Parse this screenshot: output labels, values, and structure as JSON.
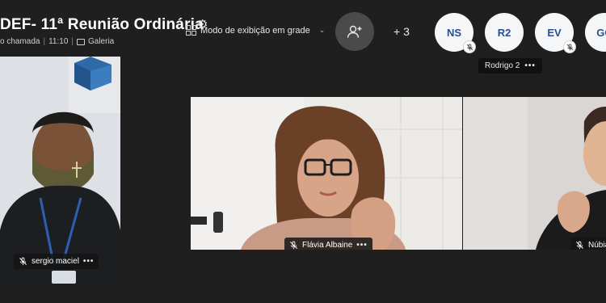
{
  "header": {
    "title": "DEF- 11ª Reunião Ordinária",
    "call_label": "o chamada",
    "time": "11:10",
    "gallery_label": "Galeria",
    "view_mode_label": "Modo de exibição em grade",
    "more_participants": "+ 3"
  },
  "participants_bar": [
    {
      "initials": "NS",
      "muted": true
    },
    {
      "initials": "R2",
      "muted": false
    },
    {
      "initials": "EV",
      "muted": true
    },
    {
      "initials": "GC",
      "muted": false
    }
  ],
  "hover_card": {
    "name": "Rodrigo 2"
  },
  "tiles": [
    {
      "name": "sergio maciel"
    },
    {
      "name": "Flávia Albaine"
    },
    {
      "name": "Núbia"
    }
  ],
  "colors": {
    "background": "#1f1f1f",
    "avatar_bg": "#f4f6f8",
    "avatar_text": "#2b4f8c",
    "add_person_bg": "#4a4a4a"
  },
  "icons": [
    "gear-icon",
    "grid-view-icon",
    "chevron-down-icon",
    "add-person-icon",
    "mic-off-icon",
    "more-icon",
    "gallery-icon"
  ]
}
